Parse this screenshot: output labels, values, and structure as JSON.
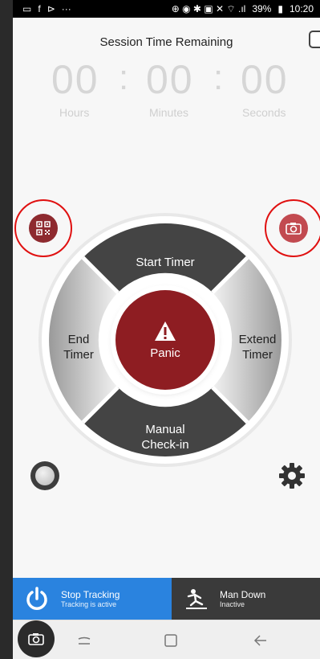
{
  "status_bar": {
    "battery": "39%",
    "time": "10:20"
  },
  "session": {
    "title": "Session Time Remaining",
    "hours": "00",
    "minutes": "00",
    "seconds": "00",
    "colon": ":",
    "hours_label": "Hours",
    "minutes_label": "Minutes",
    "seconds_label": "Seconds"
  },
  "wheel": {
    "start_timer": "Start Timer",
    "end_timer_line1": "End",
    "end_timer_line2": "Timer",
    "extend_timer_line1": "Extend",
    "extend_timer_line2": "Timer",
    "manual_checkin_line1": "Manual",
    "manual_checkin_line2": "Check-in",
    "panic": "Panic"
  },
  "action_bar": {
    "stop_tracking_title": "Stop Tracking",
    "stop_tracking_sub": "Tracking is active",
    "man_down_title": "Man Down",
    "man_down_sub": "Inactive"
  },
  "colors": {
    "accent_red": "#8e1d22",
    "tracking_blue": "#2a83df",
    "dark_segment": "#444444",
    "highlight_ring": "#e01010"
  },
  "icons": [
    "qr-code-icon",
    "camera-icon",
    "warning-icon",
    "power-icon",
    "fall-icon",
    "gear-icon",
    "toggle-icon",
    "recent-apps-icon",
    "home-icon",
    "back-icon"
  ]
}
